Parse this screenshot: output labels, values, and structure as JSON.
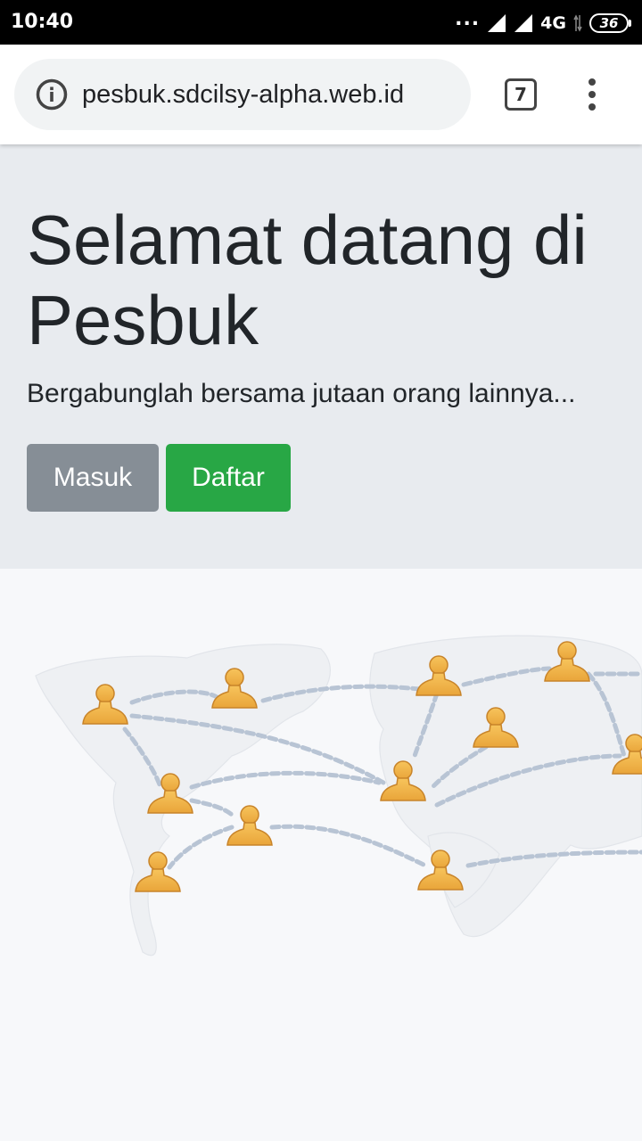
{
  "status_bar": {
    "time": "10:40",
    "dots": "...",
    "network": "4G",
    "battery": "36"
  },
  "browser": {
    "url": "pesbuk.sdcilsy-alpha.web.id",
    "tab_count": "7"
  },
  "hero": {
    "title": "Selamat datang di Pesbuk",
    "subtitle": "Bergabunglah bersama jutaan orang lainnya...",
    "login_label": "Masuk",
    "register_label": "Daftar"
  },
  "colors": {
    "jumbotron_bg": "#e8ebef",
    "masuk_button": "#868e96",
    "daftar_button": "#28a745",
    "person_icon": "#f0b04a",
    "connection_line": "#b8c4d4"
  },
  "illustration": {
    "icon": "person-network-icon"
  }
}
